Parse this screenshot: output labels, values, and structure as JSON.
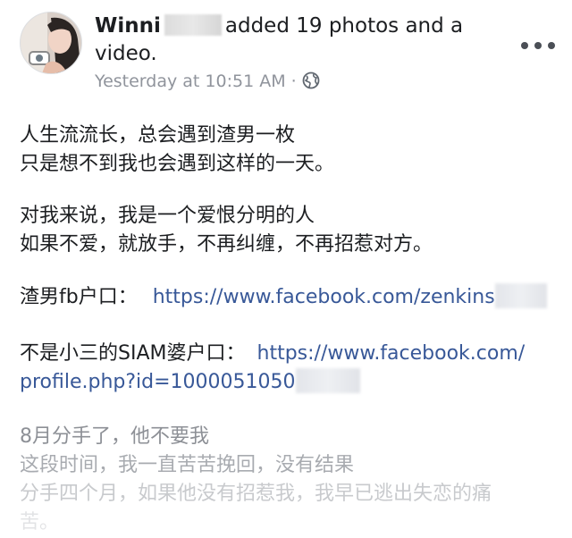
{
  "post": {
    "author": "Winni",
    "action_text": "added 19 photos and a video.",
    "timestamp": "Yesterday at 10:51 AM",
    "separator": "·",
    "privacy_icon": "globe-icon",
    "menu_icon": "more-icon"
  },
  "body": {
    "p1_line1": "人生流流长，总会遇到渣男一枚",
    "p1_line2": "只是想不到我也会遇到这样的一天。",
    "p2_line1": "对我来说，我是一个爱恨分明的人",
    "p2_line2": "如果不爱，就放手，不再纠缠，不再招惹对方。",
    "fb_label": "渣男fb户口：",
    "fb_link": "https://www.facebook.com/zenkins",
    "siam_label": "不是小三的SIAM婆户口：",
    "siam_link_part1": "https://www.facebook.com/",
    "siam_link_part2": "profile.php?id=1000051050",
    "p5_line1": "8月分手了，他不要我",
    "p5_line2": "这段时间，我一直苦苦挽回，没有结果",
    "p5_line3": "分手四个月，如果他没有招惹我，我早已逃出失恋的痛",
    "p5_line4": "苦。"
  },
  "colors": {
    "text": "#1c1e21",
    "link": "#385898",
    "meta": "#90949c"
  }
}
